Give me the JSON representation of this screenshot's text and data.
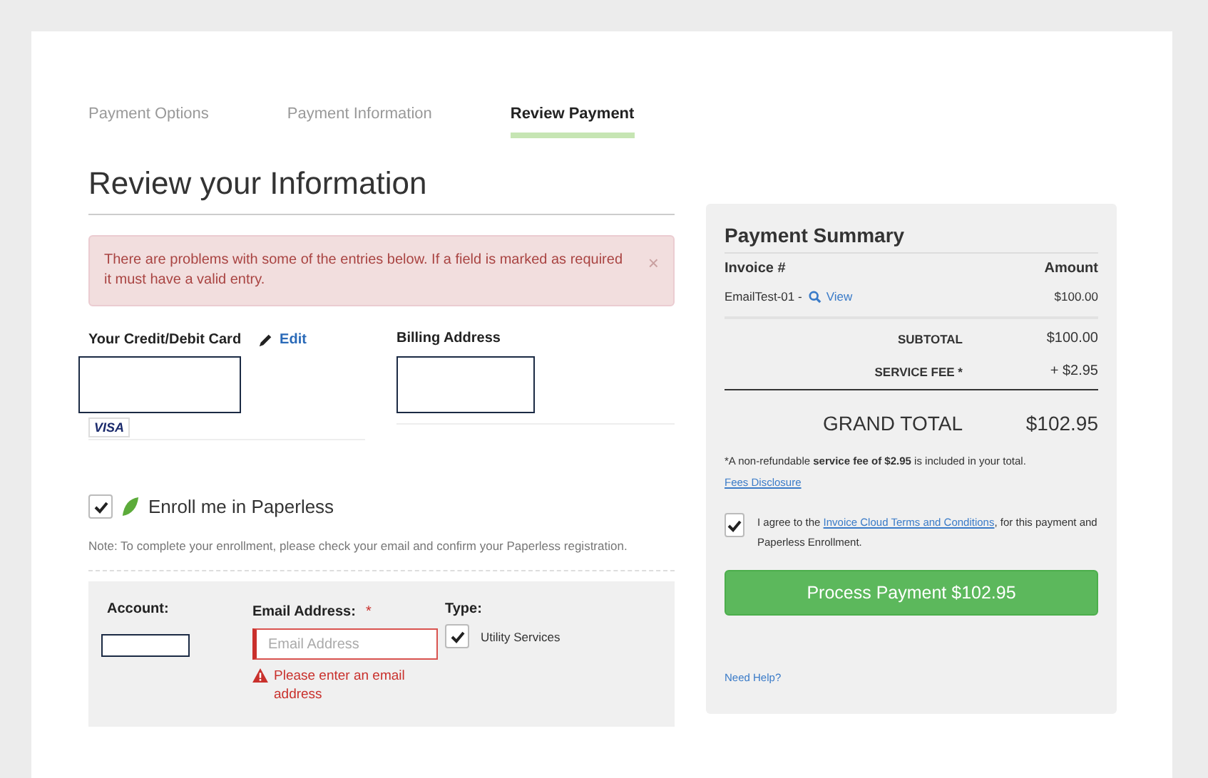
{
  "steps": [
    {
      "label": "Payment Options",
      "selected": false
    },
    {
      "label": "Payment Information",
      "selected": false
    },
    {
      "label": "Review Payment",
      "selected": true
    }
  ],
  "title": "Review your Information",
  "alert": {
    "text": "There are problems with some of the entries below. If a field is marked as required it must have a valid entry.",
    "close": "×"
  },
  "card": {
    "label": "Your Credit/Debit Card",
    "edit": "Edit",
    "brand": "VISA"
  },
  "billing": {
    "label": "Billing Address"
  },
  "paperless": {
    "checked": true,
    "label": "Enroll me in Paperless",
    "note": "Note: To complete your enrollment, please check your email and confirm your Paperless registration."
  },
  "enrollment": {
    "account_label": "Account:",
    "email_label": "Email Address:",
    "required_mark": "*",
    "email_placeholder": "Email Address",
    "email_error": "Please enter an email address",
    "type_label": "Type:",
    "type_option": {
      "label": "Utility Services",
      "checked": true
    }
  },
  "summary": {
    "title": "Payment Summary",
    "columns": [
      "Invoice #",
      "Amount"
    ],
    "invoices": [
      {
        "id": "EmailTest-01 -",
        "view": "View",
        "amount": "$100.00"
      }
    ],
    "subtotal": {
      "label": "SUBTOTAL",
      "value": "$100.00"
    },
    "fee": {
      "label": "SERVICE FEE *",
      "value": "+ $2.95"
    },
    "grand_total": {
      "label": "GRAND TOTAL",
      "value": "$102.95"
    },
    "footnote": "*A non-refundable **service fee of $2.95** is included in your total.",
    "fees_link": "Fees Disclosure",
    "agree": {
      "checked": true,
      "before": "I agree to the ",
      "link": "Invoice Cloud Terms and Conditions",
      "after": ", for this payment and Paperless Enrollment."
    },
    "button": "Process Payment $102.95",
    "help": "Need Help?"
  }
}
